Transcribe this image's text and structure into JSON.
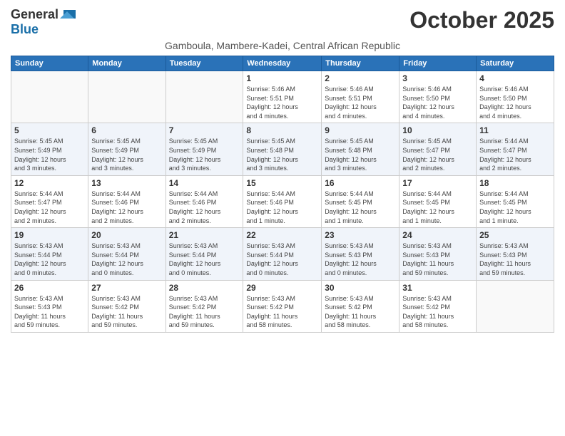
{
  "logo": {
    "general": "General",
    "blue": "Blue"
  },
  "title": "October 2025",
  "subtitle": "Gamboula, Mambere-Kadei, Central African Republic",
  "days_header": [
    "Sunday",
    "Monday",
    "Tuesday",
    "Wednesday",
    "Thursday",
    "Friday",
    "Saturday"
  ],
  "weeks": [
    {
      "alt": false,
      "days": [
        {
          "num": "",
          "info": ""
        },
        {
          "num": "",
          "info": ""
        },
        {
          "num": "",
          "info": ""
        },
        {
          "num": "1",
          "info": "Sunrise: 5:46 AM\nSunset: 5:51 PM\nDaylight: 12 hours\nand 4 minutes."
        },
        {
          "num": "2",
          "info": "Sunrise: 5:46 AM\nSunset: 5:51 PM\nDaylight: 12 hours\nand 4 minutes."
        },
        {
          "num": "3",
          "info": "Sunrise: 5:46 AM\nSunset: 5:50 PM\nDaylight: 12 hours\nand 4 minutes."
        },
        {
          "num": "4",
          "info": "Sunrise: 5:46 AM\nSunset: 5:50 PM\nDaylight: 12 hours\nand 4 minutes."
        }
      ]
    },
    {
      "alt": true,
      "days": [
        {
          "num": "5",
          "info": "Sunrise: 5:45 AM\nSunset: 5:49 PM\nDaylight: 12 hours\nand 3 minutes."
        },
        {
          "num": "6",
          "info": "Sunrise: 5:45 AM\nSunset: 5:49 PM\nDaylight: 12 hours\nand 3 minutes."
        },
        {
          "num": "7",
          "info": "Sunrise: 5:45 AM\nSunset: 5:49 PM\nDaylight: 12 hours\nand 3 minutes."
        },
        {
          "num": "8",
          "info": "Sunrise: 5:45 AM\nSunset: 5:48 PM\nDaylight: 12 hours\nand 3 minutes."
        },
        {
          "num": "9",
          "info": "Sunrise: 5:45 AM\nSunset: 5:48 PM\nDaylight: 12 hours\nand 3 minutes."
        },
        {
          "num": "10",
          "info": "Sunrise: 5:45 AM\nSunset: 5:47 PM\nDaylight: 12 hours\nand 2 minutes."
        },
        {
          "num": "11",
          "info": "Sunrise: 5:44 AM\nSunset: 5:47 PM\nDaylight: 12 hours\nand 2 minutes."
        }
      ]
    },
    {
      "alt": false,
      "days": [
        {
          "num": "12",
          "info": "Sunrise: 5:44 AM\nSunset: 5:47 PM\nDaylight: 12 hours\nand 2 minutes."
        },
        {
          "num": "13",
          "info": "Sunrise: 5:44 AM\nSunset: 5:46 PM\nDaylight: 12 hours\nand 2 minutes."
        },
        {
          "num": "14",
          "info": "Sunrise: 5:44 AM\nSunset: 5:46 PM\nDaylight: 12 hours\nand 2 minutes."
        },
        {
          "num": "15",
          "info": "Sunrise: 5:44 AM\nSunset: 5:46 PM\nDaylight: 12 hours\nand 1 minute."
        },
        {
          "num": "16",
          "info": "Sunrise: 5:44 AM\nSunset: 5:45 PM\nDaylight: 12 hours\nand 1 minute."
        },
        {
          "num": "17",
          "info": "Sunrise: 5:44 AM\nSunset: 5:45 PM\nDaylight: 12 hours\nand 1 minute."
        },
        {
          "num": "18",
          "info": "Sunrise: 5:44 AM\nSunset: 5:45 PM\nDaylight: 12 hours\nand 1 minute."
        }
      ]
    },
    {
      "alt": true,
      "days": [
        {
          "num": "19",
          "info": "Sunrise: 5:43 AM\nSunset: 5:44 PM\nDaylight: 12 hours\nand 0 minutes."
        },
        {
          "num": "20",
          "info": "Sunrise: 5:43 AM\nSunset: 5:44 PM\nDaylight: 12 hours\nand 0 minutes."
        },
        {
          "num": "21",
          "info": "Sunrise: 5:43 AM\nSunset: 5:44 PM\nDaylight: 12 hours\nand 0 minutes."
        },
        {
          "num": "22",
          "info": "Sunrise: 5:43 AM\nSunset: 5:44 PM\nDaylight: 12 hours\nand 0 minutes."
        },
        {
          "num": "23",
          "info": "Sunrise: 5:43 AM\nSunset: 5:43 PM\nDaylight: 12 hours\nand 0 minutes."
        },
        {
          "num": "24",
          "info": "Sunrise: 5:43 AM\nSunset: 5:43 PM\nDaylight: 11 hours\nand 59 minutes."
        },
        {
          "num": "25",
          "info": "Sunrise: 5:43 AM\nSunset: 5:43 PM\nDaylight: 11 hours\nand 59 minutes."
        }
      ]
    },
    {
      "alt": false,
      "days": [
        {
          "num": "26",
          "info": "Sunrise: 5:43 AM\nSunset: 5:43 PM\nDaylight: 11 hours\nand 59 minutes."
        },
        {
          "num": "27",
          "info": "Sunrise: 5:43 AM\nSunset: 5:42 PM\nDaylight: 11 hours\nand 59 minutes."
        },
        {
          "num": "28",
          "info": "Sunrise: 5:43 AM\nSunset: 5:42 PM\nDaylight: 11 hours\nand 59 minutes."
        },
        {
          "num": "29",
          "info": "Sunrise: 5:43 AM\nSunset: 5:42 PM\nDaylight: 11 hours\nand 58 minutes."
        },
        {
          "num": "30",
          "info": "Sunrise: 5:43 AM\nSunset: 5:42 PM\nDaylight: 11 hours\nand 58 minutes."
        },
        {
          "num": "31",
          "info": "Sunrise: 5:43 AM\nSunset: 5:42 PM\nDaylight: 11 hours\nand 58 minutes."
        },
        {
          "num": "",
          "info": ""
        }
      ]
    }
  ]
}
